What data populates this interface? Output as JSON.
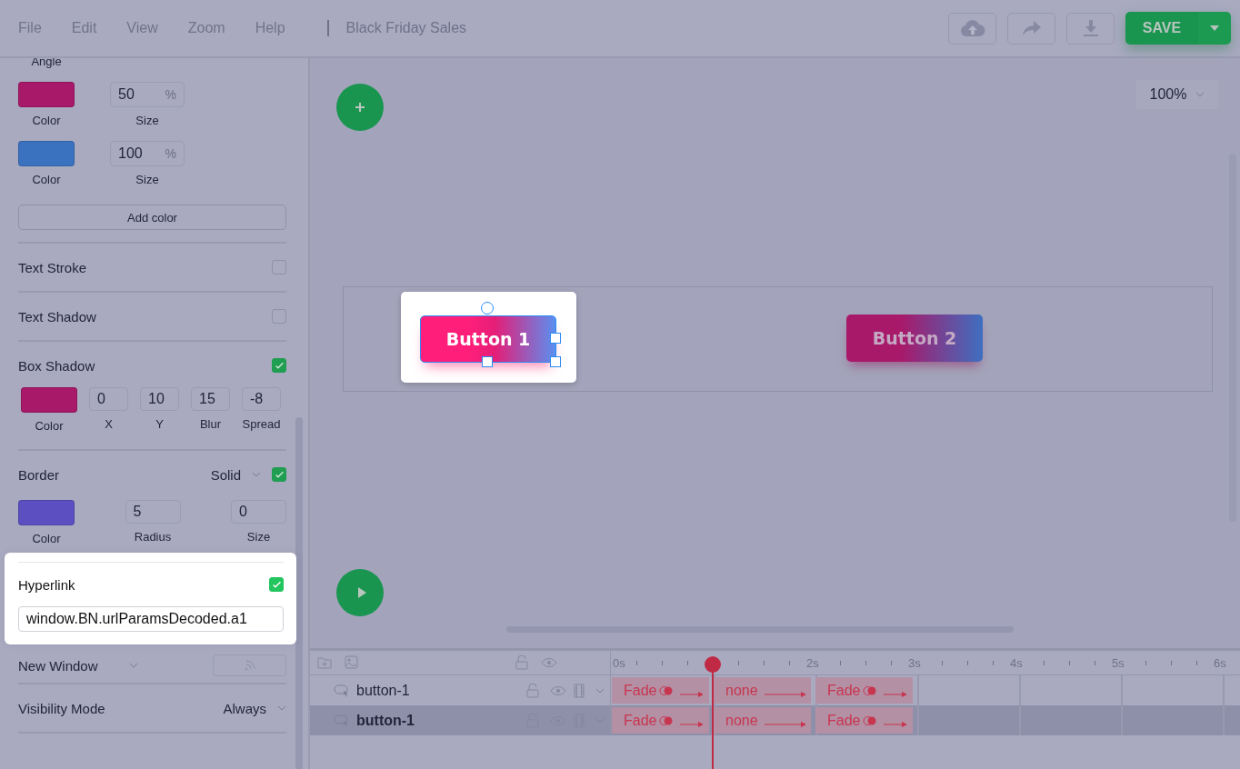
{
  "menu": [
    "File",
    "Edit",
    "View",
    "Zoom",
    "Help"
  ],
  "document_title": "Black Friday Sales",
  "save_button": "SAVE",
  "sidebar": {
    "angle_label": "Angle",
    "gradient_stops": [
      {
        "color": "#a8196a",
        "color_label": "Color",
        "size": "50",
        "unit": "%",
        "size_label": "Size"
      },
      {
        "color": "#3a72c0",
        "color_label": "Color",
        "size": "100",
        "unit": "%",
        "size_label": "Size"
      }
    ],
    "add_color_button": "Add color",
    "text_stroke": {
      "label": "Text Stroke",
      "checked": false
    },
    "text_shadow": {
      "label": "Text Shadow",
      "checked": false
    },
    "box_shadow": {
      "label": "Box Shadow",
      "checked": true,
      "color": "#a8196a",
      "color_label": "Color",
      "fields": [
        {
          "value": "0",
          "label": "X"
        },
        {
          "value": "10",
          "label": "Y"
        },
        {
          "value": "15",
          "label": "Blur"
        },
        {
          "value": "-8",
          "label": "Spread"
        }
      ]
    },
    "border": {
      "label": "Border",
      "style": "Solid",
      "checked": true,
      "color": "#5b4fc2",
      "color_label": "Color",
      "radius": "5",
      "radius_label": "Radius",
      "size": "0",
      "size_label": "Size"
    },
    "hyperlink": {
      "label": "Hyperlink",
      "checked": true,
      "value": "window.BN.urlParamsDecoded.a1"
    },
    "new_window": {
      "label": "New Window"
    },
    "visibility_mode": {
      "label": "Visibility Mode",
      "value": "Always"
    }
  },
  "canvas": {
    "zoom": "100%",
    "elements": [
      {
        "label": "Button 1",
        "selected": true
      },
      {
        "label": "Button 2",
        "selected": false
      }
    ]
  },
  "timeline": {
    "ticks_before_playhead": [
      "0s"
    ],
    "ticks_after_playhead": [
      "2s",
      "3s",
      "4s",
      "5s",
      "6s"
    ],
    "layers": [
      {
        "name": "button-1",
        "selected": false,
        "clips": [
          "Fade",
          "none",
          "Fade"
        ]
      },
      {
        "name": "button-1",
        "selected": true,
        "clips": [
          "Fade",
          "none",
          "Fade"
        ]
      }
    ]
  }
}
